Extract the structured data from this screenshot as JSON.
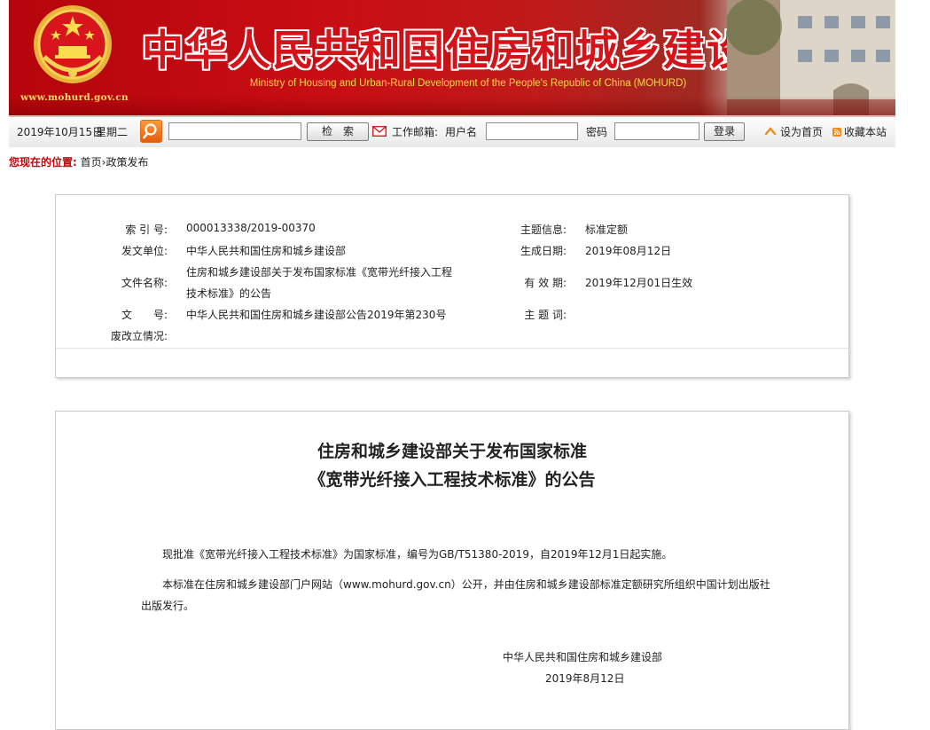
{
  "header": {
    "site_url": "www.mohurd.gov.cn",
    "title": "中华人民共和国住房和城乡建设部",
    "subtitle": "Ministry of Housing and Urban-Rural Development of the People's Republic of China (MOHURD)",
    "colors": {
      "banner_red": "#c80d14",
      "title_red": "#d4141a",
      "subtitle_gold": "#f7d74a"
    }
  },
  "toolbar": {
    "date": "2019年10月15日",
    "weekday": "星期二",
    "search_value": "",
    "search_button": "检　索",
    "mail_label": "工作邮箱:",
    "username_label": "用户名",
    "username_value": "",
    "password_label": "密码",
    "password_value": "",
    "login_button": "登录",
    "set_home": "设为首页",
    "bookmark": "收藏本站",
    "icons": [
      "search-icon",
      "mail-icon",
      "home-icon",
      "rss-icon"
    ]
  },
  "breadcrumb": {
    "prefix": "您现在的位置:",
    "home": "首页",
    "separator": "›",
    "current": "政策发布"
  },
  "info": {
    "index_label": "索 引 号:",
    "index_value": "000013338/2019-00370",
    "topic_label": "主题信息:",
    "topic_value": "标准定额",
    "issuer_label": "发文单位:",
    "issuer_value": "中华人民共和国住房和城乡建设部",
    "date_label": "生成日期:",
    "date_value": "2019年08月12日",
    "filename_label": "文件名称:",
    "filename_line1": "住房和城乡建设部关于发布国家标准《宽带光纤接入工程",
    "filename_line2": "技术标准》的公告",
    "validity_label": "有 效 期:",
    "validity_value": "2019年12月01日生效",
    "docno_label": "文　　号:",
    "docno_value": "中华人民共和国住房和城乡建设部公告2019年第230号",
    "keyword_label": "主 题 词:",
    "keyword_value": "",
    "status_label": "废改立情况:",
    "status_value": ""
  },
  "article": {
    "title_line1": "住房和城乡建设部关于发布国家标准",
    "title_line2": "《宽带光纤接入工程技术标准》的公告",
    "para1": "现批准《宽带光纤接入工程技术标准》为国家标准，编号为GB/T51380-2019，自2019年12月1日起实施。",
    "para2_line1": "本标准在住房和城乡建设部门户网站（www.mohurd.gov.cn）公开，并由住房和城乡建设部标准定额研究所组织中国计划出版社",
    "para2_line2": "出版发行。",
    "signature": "中华人民共和国住房和城乡建设部",
    "sign_date": "2019年8月12日"
  }
}
